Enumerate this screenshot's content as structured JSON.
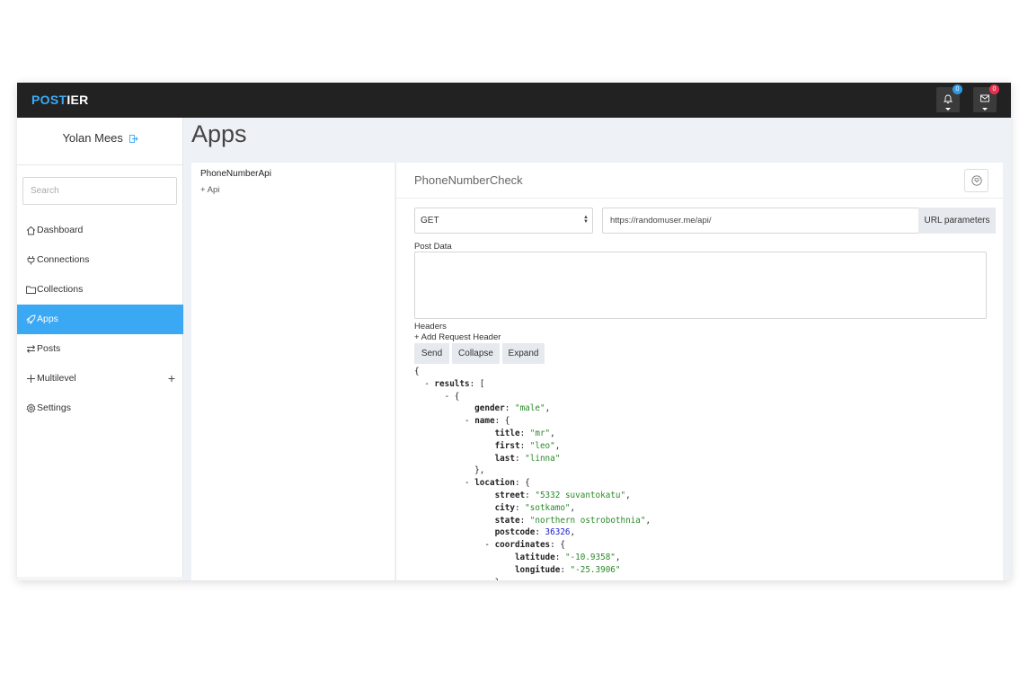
{
  "brand": {
    "accent": "POST",
    "rest": "IER"
  },
  "notifications": {
    "bell_count": "0",
    "mail_count": "0"
  },
  "user": {
    "name": "Yolan Mees"
  },
  "search": {
    "placeholder": "Search"
  },
  "nav": {
    "dashboard": "Dashboard",
    "connections": "Connections",
    "collections": "Collections",
    "apps": "Apps",
    "posts": "Posts",
    "multilevel": "Multilevel",
    "settings": "Settings",
    "active": "Apps"
  },
  "page": {
    "title": "Apps"
  },
  "apps": {
    "item": "PhoneNumberApi",
    "add_api": "+ Api"
  },
  "detail": {
    "title": "PhoneNumberCheck",
    "method": "GET",
    "url": "https://randomuser.me/api/",
    "url_params_label": "URL parameters",
    "post_data_label": "Post Data",
    "headers_label": "Headers",
    "add_header": "+ Add Request Header",
    "send": "Send",
    "collapse": "Collapse",
    "expand": "Expand"
  },
  "json_view": {
    "open": "{",
    "results_key": "results",
    "results_open": ": [",
    "item_open": "- {",
    "gender_key": "gender",
    "gender_val": "\"male\"",
    "name_key": "name",
    "obj_open": ": {",
    "title_key": "title",
    "title_val": "\"mr\"",
    "first_key": "first",
    "first_val": "\"leo\"",
    "last_key": "last",
    "last_val": "\"linna\"",
    "close_obj_comma": "},",
    "location_key": "location",
    "street_key": "street",
    "street_val": "\"5332 suvantokatu\"",
    "city_key": "city",
    "city_val": "\"sotkamo\"",
    "state_key": "state",
    "state_val": "\"northern ostrobothnia\"",
    "postcode_key": "postcode",
    "postcode_val": "36326",
    "coordinates_key": "coordinates",
    "latitude_key": "latitude",
    "latitude_val": "\"-10.9358\"",
    "longitude_key": "longitude",
    "longitude_val": "\"-25.3906\"",
    "close_partial": "},"
  },
  "colors": {
    "accent": "#3aa8f3",
    "topbar": "#222222",
    "badge_blue": "#2f9ae6",
    "badge_red": "#e8314e",
    "json_string": "#2a8a2a",
    "json_number": "#1a1ad0"
  }
}
